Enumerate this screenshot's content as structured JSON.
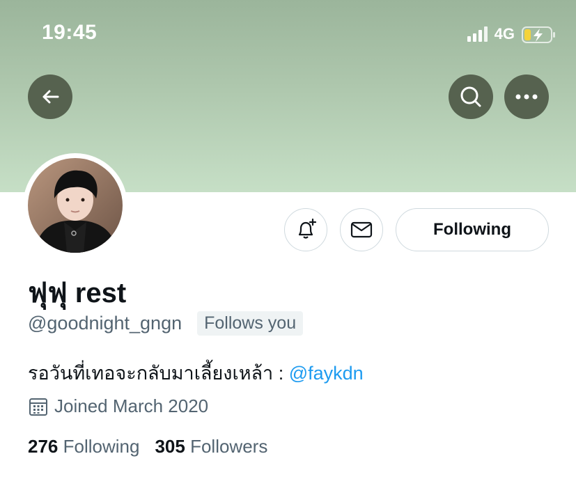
{
  "status_bar": {
    "time": "19:45",
    "network": "4G",
    "signal_bars": 4,
    "battery": "charging-low"
  },
  "header": {
    "back_icon": "back-arrow-icon",
    "search_icon": "search-icon",
    "more_icon": "more-dots-icon"
  },
  "colors": {
    "banner_top": "#9bb59b",
    "banner_bottom": "#c6dfc6",
    "header_button": "#56624f",
    "mention": "#1d9bf0",
    "secondary_text": "#536471"
  },
  "profile": {
    "display_name": "ฟุฟุ rest",
    "handle": "@goodnight_gngn",
    "follows_you": "Follows you",
    "bio_text": "รอวันที่เทอจะกลับมาเลี้ยงเหล้า : ",
    "bio_mention": "@faykdn",
    "joined": "Joined March 2020",
    "following_count": "276",
    "following_label": "Following",
    "followers_count": "305",
    "followers_label": "Followers"
  },
  "actions": {
    "notify_icon": "bell-plus-icon",
    "message_icon": "envelope-icon",
    "following_button": "Following"
  }
}
